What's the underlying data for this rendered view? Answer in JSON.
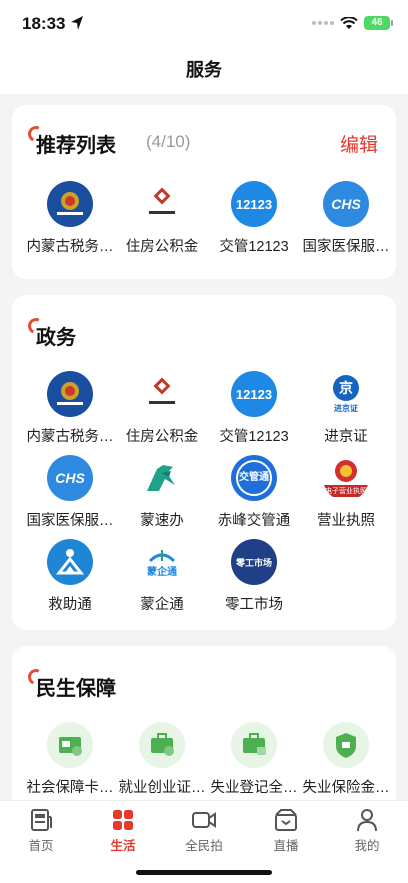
{
  "status": {
    "time": "18:33",
    "battery": "46"
  },
  "nav": {
    "title": "服务"
  },
  "recommend": {
    "title": "推荐列表",
    "count": "(4/10)",
    "edit": "编辑",
    "items": [
      {
        "label": "内蒙古税务…",
        "icon": "tax-bureau-icon"
      },
      {
        "label": "住房公积金",
        "icon": "housing-fund-icon"
      },
      {
        "label": "交管12123",
        "icon": "traffic-12123-icon"
      },
      {
        "label": "国家医保服…",
        "icon": "chs-medical-insurance-icon"
      }
    ]
  },
  "gov": {
    "title": "政务",
    "items": [
      {
        "label": "内蒙古税务…",
        "icon": "tax-bureau-icon"
      },
      {
        "label": "住房公积金",
        "icon": "housing-fund-icon"
      },
      {
        "label": "交管12123",
        "icon": "traffic-12123-icon"
      },
      {
        "label": "进京证",
        "icon": "beijing-permit-icon"
      },
      {
        "label": "国家医保服…",
        "icon": "chs-medical-insurance-icon"
      },
      {
        "label": "蒙速办",
        "icon": "mengsuban-horse-icon"
      },
      {
        "label": "赤峰交管通",
        "icon": "chifeng-traffic-icon"
      },
      {
        "label": "营业执照",
        "icon": "business-license-icon"
      },
      {
        "label": "救助通",
        "icon": "rescue-icon"
      },
      {
        "label": "蒙企通",
        "icon": "mengqitong-icon"
      },
      {
        "label": "零工市场",
        "icon": "gig-market-icon"
      }
    ]
  },
  "welfare": {
    "title": "民生保障",
    "items": [
      {
        "label": "社会保障卡…",
        "icon": "social-security-card-icon"
      },
      {
        "label": "就业创业证…",
        "icon": "employment-certificate-icon"
      },
      {
        "label": "失业登记全…",
        "icon": "unemployment-registration-icon"
      },
      {
        "label": "失业保险金…",
        "icon": "unemployment-insurance-icon"
      }
    ]
  },
  "icon_text": {
    "traffic": "12123",
    "chs": "CHS",
    "jing": "京",
    "jing_caption": "进京证",
    "jiaoguan": "交管通",
    "license": "电子营业执照",
    "mengqi": "蒙企通",
    "linggong": "零工市场"
  },
  "tabs": [
    {
      "label": "首页",
      "icon": "newspaper-icon",
      "active": false
    },
    {
      "label": "生活",
      "icon": "grid-icon",
      "active": true
    },
    {
      "label": "全民拍",
      "icon": "video-camera-icon",
      "active": false
    },
    {
      "label": "直播",
      "icon": "live-tv-icon",
      "active": false
    },
    {
      "label": "我的",
      "icon": "person-icon",
      "active": false
    }
  ],
  "colors": {
    "accent": "#e6382c",
    "tax_blue": "#1a4fa0",
    "traffic_blue": "#1e88e5",
    "welfare_green": "#e6f5e6"
  }
}
